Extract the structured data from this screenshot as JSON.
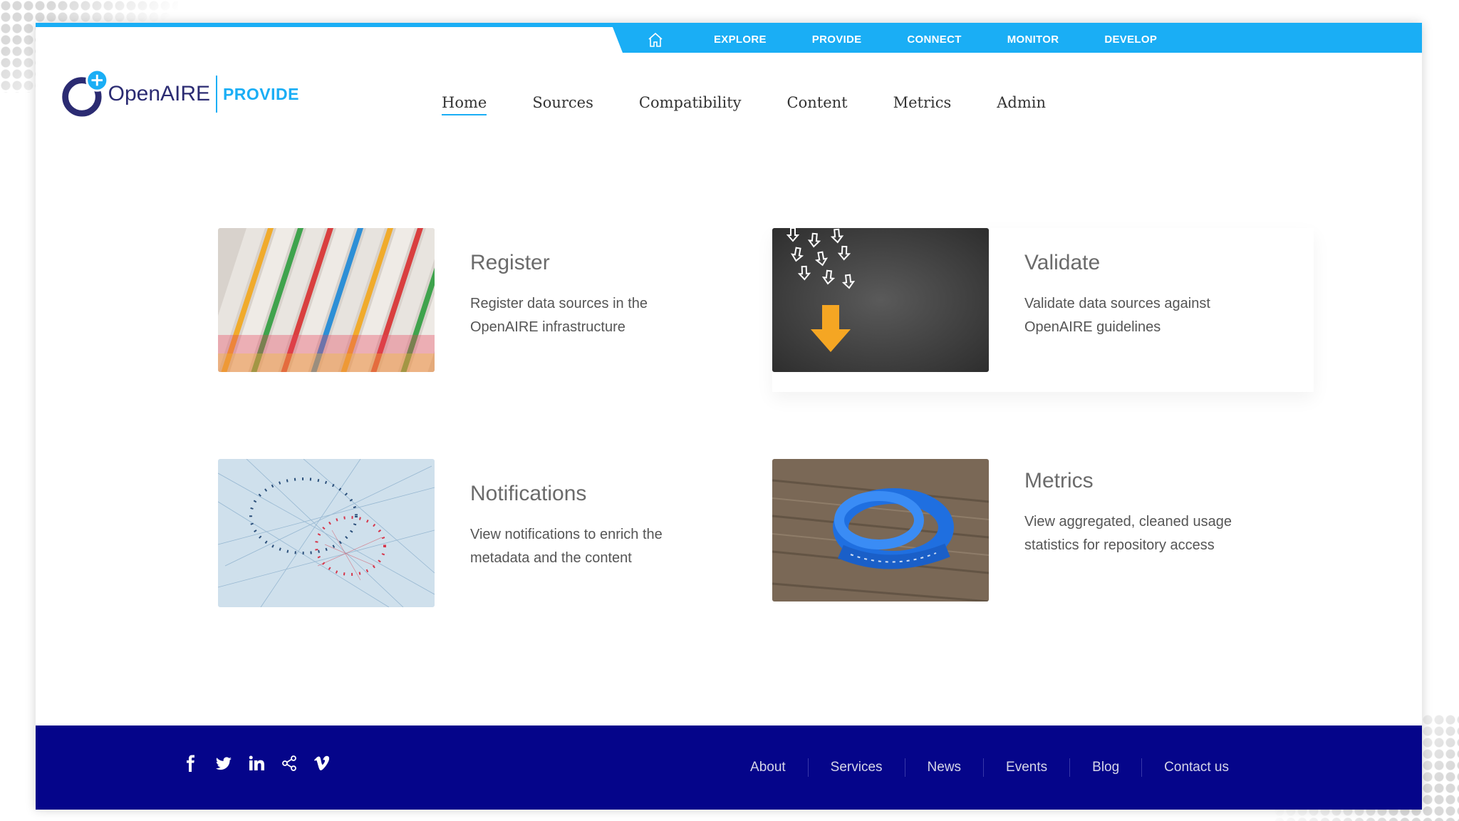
{
  "global_menu": {
    "home_icon": "home-icon",
    "items": [
      "EXPLORE",
      "PROVIDE",
      "CONNECT",
      "MONITOR",
      "DEVELOP"
    ]
  },
  "logo": {
    "name": "OpenAIRE",
    "product": "PROVIDE"
  },
  "main_nav": {
    "items": [
      "Home",
      "Sources",
      "Compatibility",
      "Content",
      "Metrics",
      "Admin"
    ],
    "active": "Home"
  },
  "cards": [
    {
      "title": "Register",
      "description": "Register data sources in the OpenAIRE infrastructure",
      "image": "file-folders-image"
    },
    {
      "title": "Validate",
      "description": "Validate data sources against OpenAIRE guidelines",
      "image": "arrows-chalkboard-image"
    },
    {
      "title": "Notifications",
      "description": "View notifications to enrich the metadata and the content",
      "image": "string-network-image"
    },
    {
      "title": "Metrics",
      "description": "View aggregated, cleaned usage statistics for repository access",
      "image": "measuring-tape-image"
    }
  ],
  "footer": {
    "social_icons": [
      "facebook-icon",
      "twitter-icon",
      "linkedin-icon",
      "share-icon",
      "vimeo-icon"
    ],
    "links": [
      "About",
      "Services",
      "News",
      "Events",
      "Blog",
      "Contact us"
    ]
  },
  "colors": {
    "accent": "#1aaef5",
    "brand_dark": "#2b2b72",
    "footer_bg": "#05058a"
  }
}
